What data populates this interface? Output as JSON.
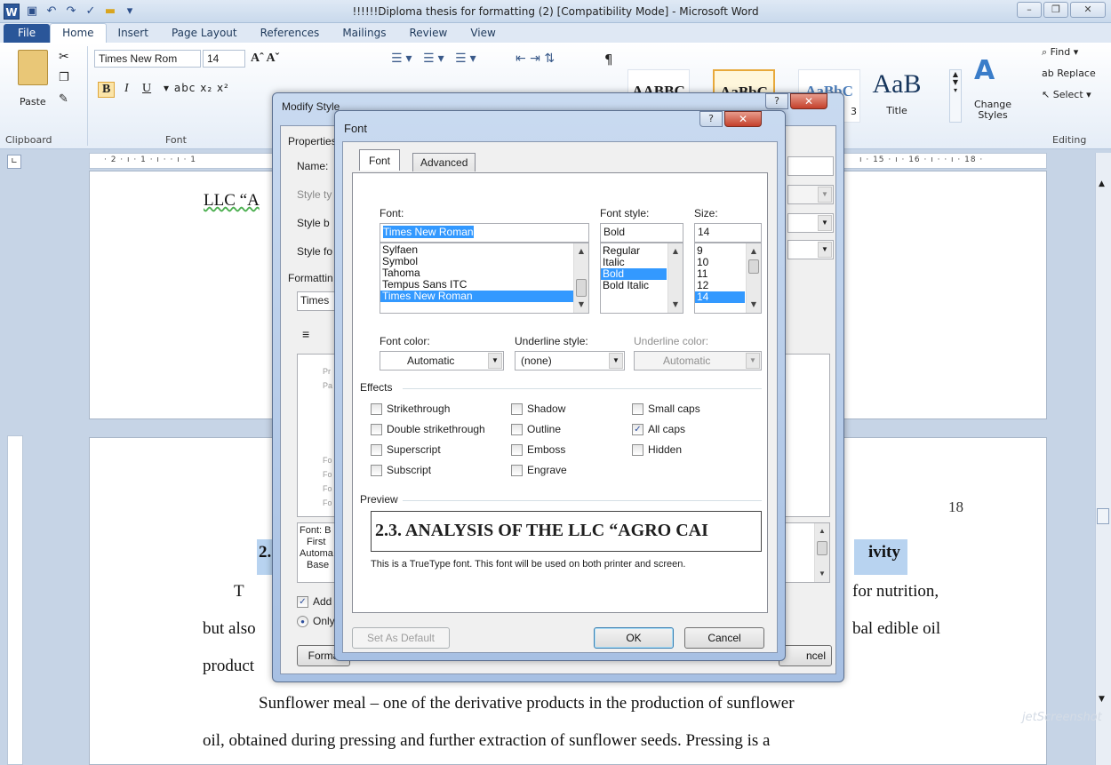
{
  "window": {
    "title": "!!!!!!Diploma thesis for formatting (2) [Compatibility Mode]  -  Microsoft Word",
    "logo": "W",
    "min": "–",
    "max": "❐",
    "close": "✕"
  },
  "ribbon_tabs": [
    "File",
    "Home",
    "Insert",
    "Page Layout",
    "References",
    "Mailings",
    "Review",
    "View"
  ],
  "ribbon": {
    "font_name": "Times New Rom",
    "font_size": "14",
    "paste": "Paste",
    "clipboard_label": "Clipboard",
    "font_label": "Font",
    "styles": [
      {
        "sample": "AABBC",
        "name": ""
      },
      {
        "sample": "AaBbC",
        "name": ""
      },
      {
        "sample": "AaBbC",
        "name": "3"
      },
      {
        "sample": "AaB",
        "name": "Title"
      }
    ],
    "change_styles": "Change Styles",
    "find": "Find",
    "replace": "Replace",
    "select": "Select",
    "editing_label": "Editing"
  },
  "ruler_text": "· 2 · ı · 1 · ı ·   · ı · 1",
  "ruler_text_right": "ı · 15 · ı · 16 · ı ·   · ı · 18 ·",
  "document": {
    "line1": "LLC “A",
    "heading_left": "2.",
    "heading_right": "ivity",
    "page_number": "18",
    "p1_start": "T",
    "p1_end": "for nutrition,",
    "p2_start": "but also",
    "p2_end": "bal edible oil",
    "p3_start": "product",
    "p4": "Sunflower meal – one of the derivative products in the production of sunflower",
    "p5": "oil, obtained during pressing and further extraction of sunflower seeds. Pressing is a"
  },
  "modify_style": {
    "title": "Modify Style",
    "properties": "Properties",
    "name": "Name:",
    "style_type": "Style ty",
    "style_based": "Style b",
    "style_following": "Style fo",
    "formatting": "Formattin",
    "font_field": "Times",
    "desc": [
      "Font: B",
      "First",
      "Automa",
      "Base"
    ],
    "add_template": "Add t",
    "only_in": "Only i",
    "format_btn": "Forma",
    "cancel_btn": "ncel",
    "preview_fragments": [
      "Pr",
      "Pa",
      "Fo",
      "Fo",
      "Fo",
      "Fo"
    ]
  },
  "font_dialog": {
    "title": "Font",
    "help": "?",
    "close": "✕",
    "tabs": [
      "Font",
      "Advanced"
    ],
    "font_label": "Font:",
    "font_value": "Times New Roman",
    "font_list": [
      "Sylfaen",
      "Symbol",
      "Tahoma",
      "Tempus Sans ITC",
      "Times New Roman"
    ],
    "font_selected": "Times New Roman",
    "style_label": "Font style:",
    "style_value": "Bold",
    "style_list": [
      "Regular",
      "Italic",
      "Bold",
      "Bold Italic"
    ],
    "style_selected": "Bold",
    "size_label": "Size:",
    "size_value": "14",
    "size_list": [
      "9",
      "10",
      "11",
      "12",
      "14"
    ],
    "size_selected": "14",
    "font_color_label": "Font color:",
    "font_color_value": "Automatic",
    "underline_style_label": "Underline style:",
    "underline_style_value": "(none)",
    "underline_color_label": "Underline color:",
    "underline_color_value": "Automatic",
    "effects_label": "Effects",
    "effects": [
      {
        "label": "Strikethrough",
        "checked": false
      },
      {
        "label": "Double strikethrough",
        "checked": false
      },
      {
        "label": "Superscript",
        "checked": false
      },
      {
        "label": "Subscript",
        "checked": false
      },
      {
        "label": "Shadow",
        "checked": false
      },
      {
        "label": "Outline",
        "checked": false
      },
      {
        "label": "Emboss",
        "checked": false
      },
      {
        "label": "Engrave",
        "checked": false
      },
      {
        "label": "Small caps",
        "checked": false
      },
      {
        "label": "All caps",
        "checked": true
      },
      {
        "label": "Hidden",
        "checked": false
      }
    ],
    "preview_label": "Preview",
    "preview_text": "2.3. ANALYSIS OF THE LLC “AGRO CAI",
    "preview_note": "This is a TrueType font. This font will be used on both printer and screen.",
    "set_default": "Set As Default",
    "ok": "OK",
    "cancel": "Cancel"
  },
  "colors": {
    "accent": "#2a5699",
    "selection": "#3399ff",
    "heading_highlight": "#b8d3f0"
  },
  "watermark": "jetScreenshot"
}
